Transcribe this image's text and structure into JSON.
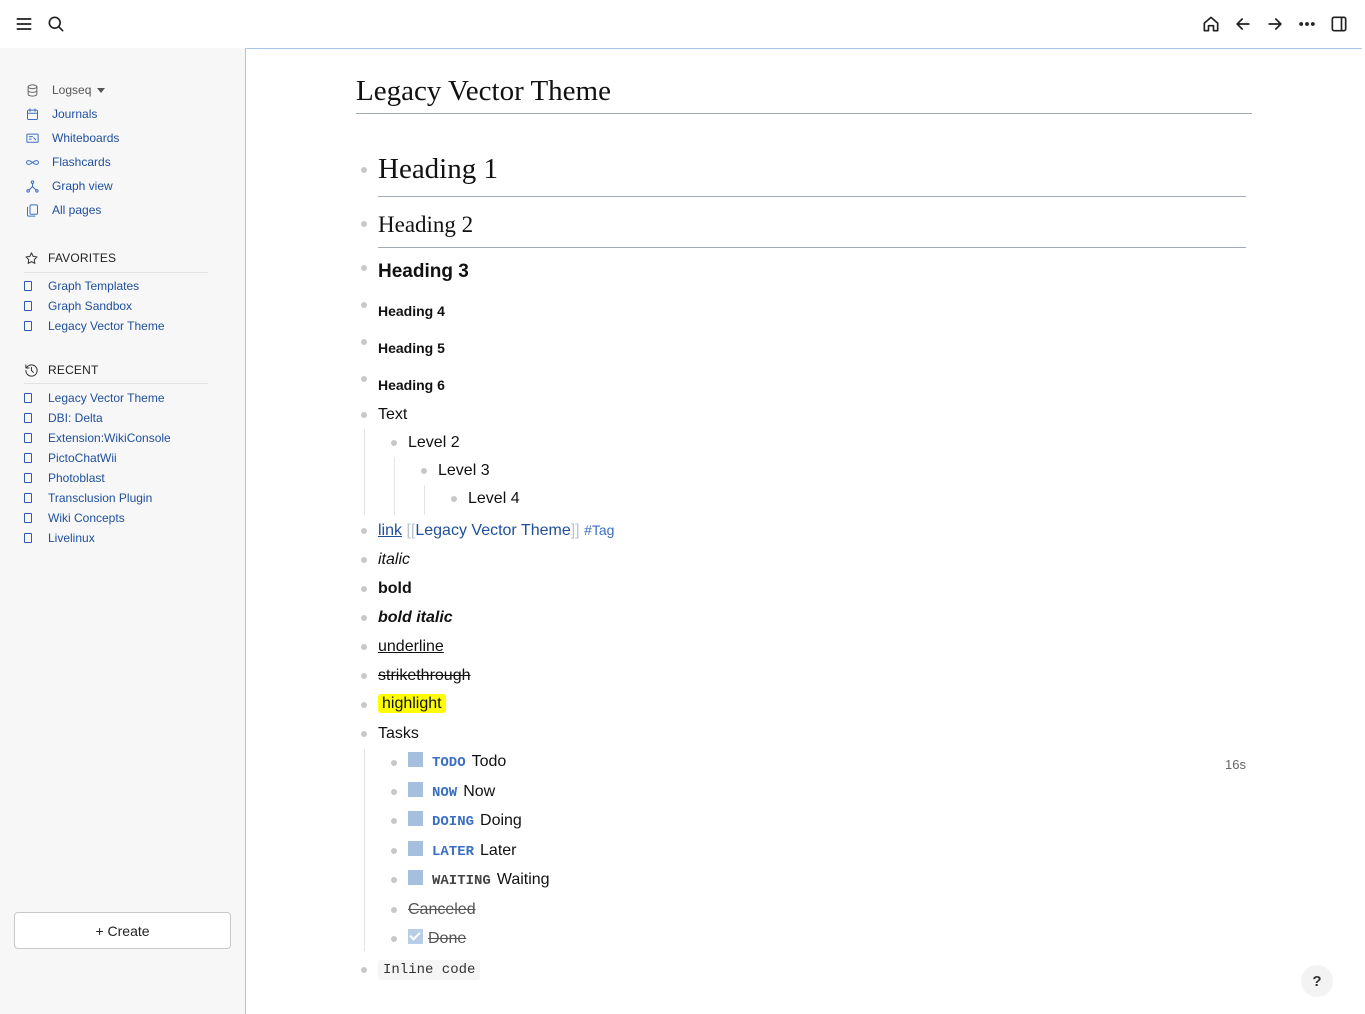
{
  "topbar": {
    "menu_icon": "menu-icon",
    "search_icon": "search-icon",
    "home_icon": "home-icon",
    "back_icon": "arrow-left-icon",
    "forward_icon": "arrow-right-icon",
    "more_icon": "more-icon",
    "sidebar_toggle_icon": "right-sidebar-icon"
  },
  "sidebar": {
    "graph_name": "Logseq",
    "nav": [
      {
        "label": "Journals",
        "icon": "calendar-icon"
      },
      {
        "label": "Whiteboards",
        "icon": "whiteboard-icon"
      },
      {
        "label": "Flashcards",
        "icon": "infinity-icon"
      },
      {
        "label": "Graph view",
        "icon": "graph-icon"
      },
      {
        "label": "All pages",
        "icon": "pages-icon"
      }
    ],
    "favorites_title": "FAVORITES",
    "favorites": [
      "Graph Templates",
      "Graph Sandbox",
      "Legacy Vector Theme"
    ],
    "recent_title": "RECENT",
    "recent": [
      "Legacy Vector Theme",
      "DBI: Delta",
      "Extension:WikiConsole",
      "PictoChatWii",
      "Photoblast",
      "Transclusion Plugin",
      "Wiki Concepts",
      "Livelinux"
    ],
    "create_label": "+ Create"
  },
  "page": {
    "title": "Legacy Vector Theme",
    "headings": [
      "Heading 1",
      "Heading 2",
      "Heading 3",
      "Heading 4",
      "Heading 5",
      "Heading 6"
    ],
    "text_block": "Text",
    "levels": [
      "Level 2",
      "Level 3",
      "Level 4"
    ],
    "link_text": "link",
    "page_ref_open": "[[",
    "page_ref": "Legacy Vector Theme",
    "page_ref_close": "]]",
    "tag": "#Tag",
    "italic": "italic",
    "bold": "bold",
    "bold_italic": "bold italic",
    "underline": "underline",
    "strikethrough": "strikethrough",
    "highlight": "highlight",
    "tasks_title": "Tasks",
    "tasks": [
      {
        "marker": "TODO",
        "text": "Todo"
      },
      {
        "marker": "NOW",
        "text": "Now"
      },
      {
        "marker": "DOING",
        "text": "Doing"
      },
      {
        "marker": "LATER",
        "text": "Later"
      },
      {
        "marker": "WAITING",
        "text": "Waiting"
      }
    ],
    "timer": "16s",
    "canceled": "Canceled",
    "done": "Done",
    "inline_code": "Inline code"
  },
  "help_label": "?"
}
